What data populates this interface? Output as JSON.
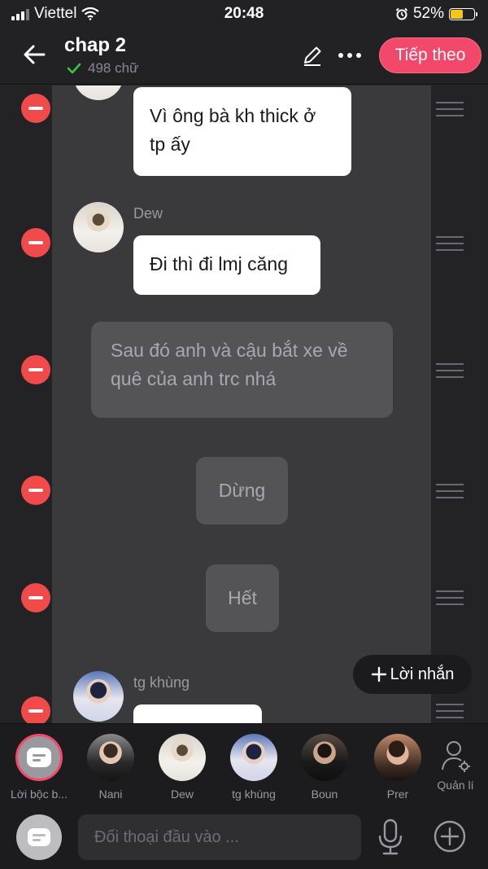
{
  "status_bar": {
    "carrier": "Viettel",
    "time": "20:48",
    "battery": "52%",
    "battery_level": 0.52
  },
  "header": {
    "title": "chap 2",
    "word_count": "498 chữ",
    "next_button": "Tiếp theo"
  },
  "messages": [
    {
      "text": "Vì ông bà kh thick ở tp ấy"
    },
    {
      "speaker": "Dew",
      "text": "Đi thì đi lmj căng"
    },
    {
      "text": "Sau đó anh và cậu bắt xe về quê  của anh trc nhá"
    },
    {
      "text": "Dừng"
    },
    {
      "text": "Hết"
    },
    {
      "speaker": "tg khùng",
      "text": ""
    }
  ],
  "add_note_button": "Lời nhắn",
  "characters": [
    {
      "label": "Lời bộc b..."
    },
    {
      "label": "Nani"
    },
    {
      "label": "Dew"
    },
    {
      "label": "tg khùng"
    },
    {
      "label": "Boun"
    },
    {
      "label": "Prer"
    },
    {
      "label": "Quản lí"
    }
  ],
  "input": {
    "placeholder": "Đối thoại đầu vào ..."
  }
}
